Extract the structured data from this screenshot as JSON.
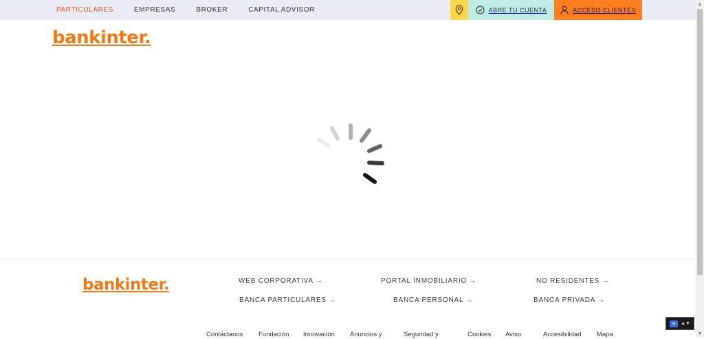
{
  "top_nav": {
    "items": [
      {
        "label": "PARTICULARES",
        "active": true
      },
      {
        "label": "EMPRESAS",
        "active": false
      },
      {
        "label": "BROKER",
        "active": false
      },
      {
        "label": "CAPITAL ADVISOR",
        "active": false
      }
    ]
  },
  "utility_bar": {
    "location_icon": "map-pin-icon",
    "open_account": {
      "label": "ABRE TU CUENTA",
      "icon": "check-circle-icon"
    },
    "client_access": {
      "label": "ACCESO CLIENTES",
      "icon": "user-icon"
    }
  },
  "brand": {
    "logo_text": "bankinter.",
    "color": "#f07a16"
  },
  "loading": {
    "icon": "spinner-icon"
  },
  "footer": {
    "logo_text": "bankinter.",
    "links": [
      {
        "label": "WEB CORPORATIVA",
        "arrow": "→"
      },
      {
        "label": "PORTAL INMOBILIARIO",
        "arrow": "→"
      },
      {
        "label": "NO RESIDENTES",
        "arrow": "→"
      },
      {
        "label": "BANCA PARTICULARES",
        "arrow": "→"
      },
      {
        "label": "BANCA PERSONAL",
        "arrow": "→"
      },
      {
        "label": "BANCA PRIVADA",
        "arrow": "→"
      }
    ],
    "bottom_links": [
      "Contáctanos",
      "Fundación",
      "Innovación",
      "Anuncios y",
      "Seguridad y",
      "Cookies",
      "Aviso",
      "Accesibilidad",
      "Mapa"
    ]
  },
  "colors": {
    "accent_orange": "#ff7f1e",
    "accent_yellow": "#ffd54a",
    "accent_mint": "#bfece4",
    "topbar_bg": "#eaecf5",
    "active_nav": "#e2561d"
  }
}
